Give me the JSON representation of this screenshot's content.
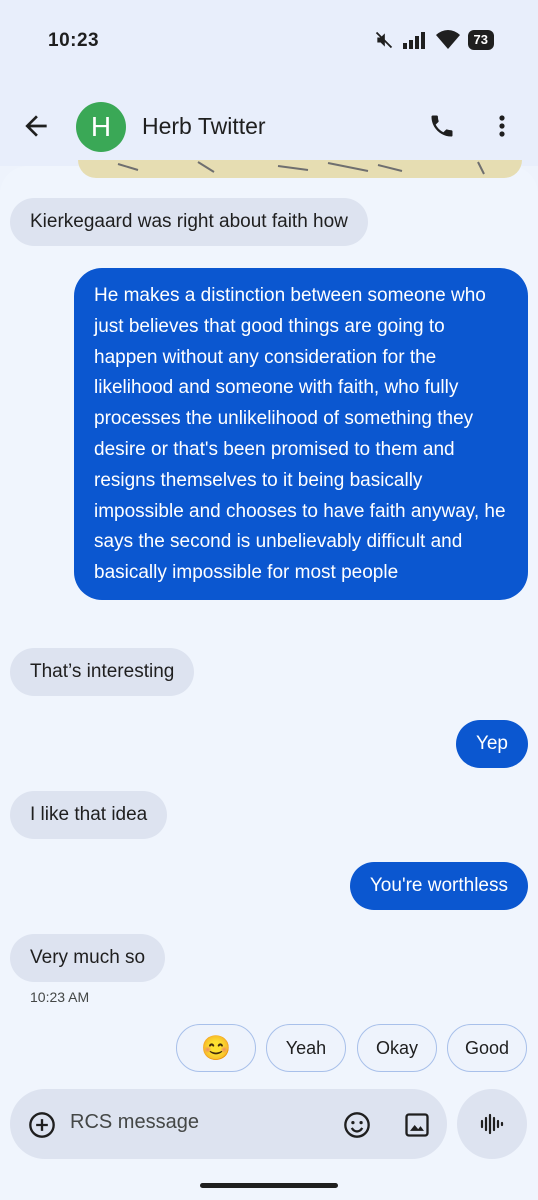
{
  "status": {
    "time": "10:23",
    "battery": "73"
  },
  "header": {
    "avatar_letter": "H",
    "contact": "Herb Twitter"
  },
  "messages": [
    {
      "dir": "in",
      "text": "Kierkegaard was right about faith how"
    },
    {
      "dir": "out",
      "text": "He makes a distinction between someone who just believes that good things are going to happen without any consideration for the likelihood and someone with faith, who fully processes the unlikelihood of something they desire or that's been promised to them and resigns themselves to it being basically impossible and chooses to have faith anyway, he says the second is unbelievably difficult and basically impossible for most people"
    },
    {
      "dir": "in",
      "text": "That’s interesting"
    },
    {
      "dir": "out",
      "text": "Yep"
    },
    {
      "dir": "in",
      "text": "I like that idea"
    },
    {
      "dir": "out",
      "text": "You're worthless"
    },
    {
      "dir": "in",
      "text": "Very much so"
    }
  ],
  "last_timestamp": "10:23 AM",
  "smart_replies": [
    "😊",
    "Yeah",
    "Okay",
    "Good"
  ],
  "composer": {
    "placeholder": "RCS message"
  },
  "colors": {
    "outgoing": "#0b57d0",
    "incoming": "#dde3f0",
    "avatar": "#3aa856"
  },
  "icons": [
    "back-arrow-icon",
    "phone-icon",
    "more-vert-icon",
    "plus-circle-icon",
    "emoji-icon",
    "image-icon",
    "voice-waveform-icon",
    "mute-icon",
    "signal-icon",
    "wifi-icon"
  ]
}
